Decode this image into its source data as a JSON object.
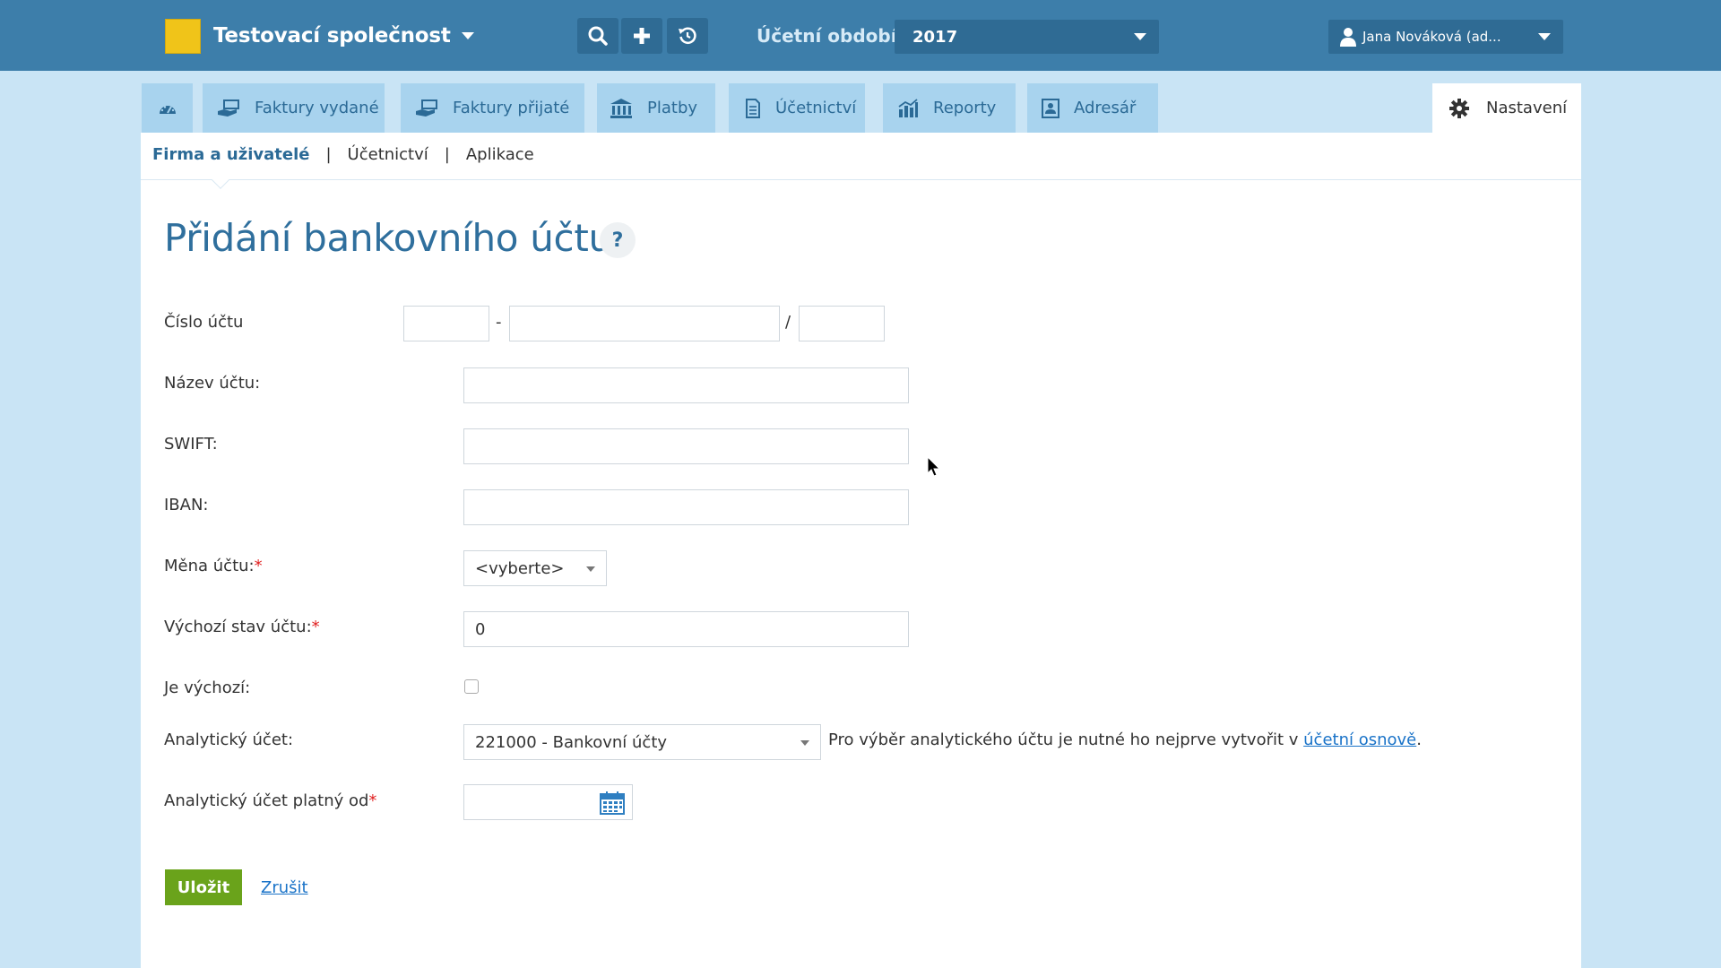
{
  "topbar": {
    "company_name": "Testovací společnost",
    "period_label": "Účetní období:",
    "period_value": "2017",
    "user_name": "Jana Nováková (ad..."
  },
  "nav": {
    "tabs": [
      {
        "label": ""
      },
      {
        "label": "Faktury vydané"
      },
      {
        "label": "Faktury přijaté"
      },
      {
        "label": "Platby"
      },
      {
        "label": "Účetnictví"
      },
      {
        "label": "Reporty"
      },
      {
        "label": "Adresář"
      }
    ],
    "settings_label": "Nastavení"
  },
  "subnav": {
    "items": [
      "Firma a uživatelé",
      "Účetnictví",
      "Aplikace"
    ],
    "separator": "|"
  },
  "page": {
    "title": "Přidání bankovního účtu",
    "help": "?"
  },
  "form": {
    "account_number_label": "Číslo účtu",
    "account_sep_dash": "-",
    "account_sep_slash": "/",
    "account_name_label": "Název účtu:",
    "swift_label": "SWIFT:",
    "iban_label": "IBAN:",
    "currency_label": "Měna účtu:",
    "currency_value": "<vyberte>",
    "initial_balance_label": "Výchozí stav účtu:",
    "initial_balance_value": "0",
    "is_default_label": "Je výchozí:",
    "analytic_label": "Analytický účet:",
    "analytic_value": "221000 - Bankovní účty",
    "analytic_hint": "Pro výběr analytického účtu je nutné ho nejprve vytvořit v ",
    "analytic_hint_link": "účetní osnově",
    "analytic_hint_end": ".",
    "analytic_valid_label": "Analytický účet platný od",
    "required_mark": "*",
    "save_label": "Uložit",
    "cancel_label": "Zrušit"
  },
  "colors": {
    "topbar": "#3d7eaa",
    "tab": "#a8d3ee",
    "title": "#2f6f9d",
    "save": "#6aa31b",
    "link": "#1a73c8"
  }
}
